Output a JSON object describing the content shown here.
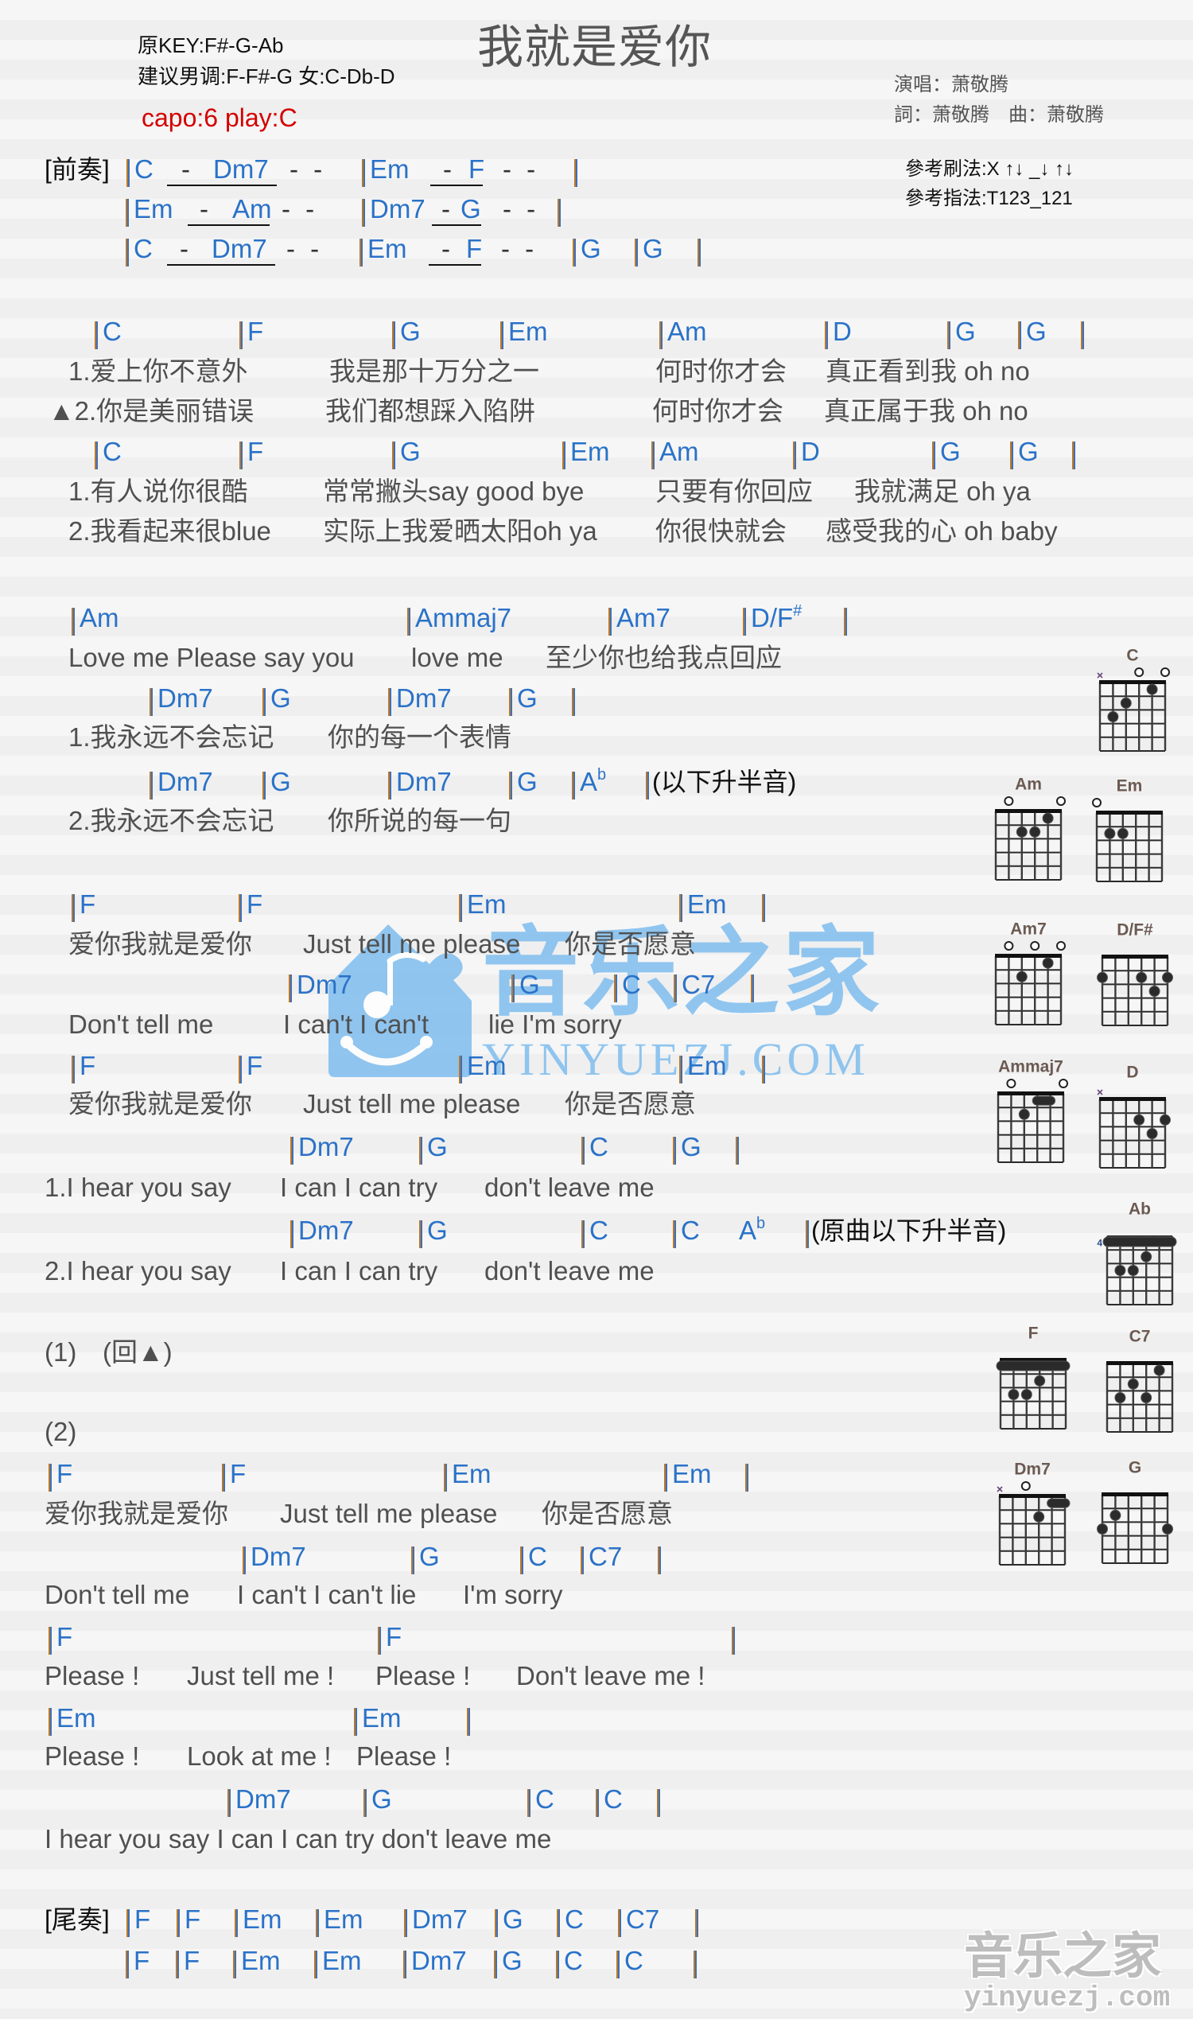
{
  "header": {
    "original_key": "原KEY:F#-G-Ab",
    "suggested_key": "建议男调:F-F#-G 女:C-Db-D",
    "capo": "capo:6 play:C",
    "title": "我就是爱你",
    "singer": "演唱：萧敬腾",
    "credits": "詞：萧敬腾　曲：萧敬腾",
    "strum": "參考刷法:X ↑↓ _↓ ↑↓",
    "fingering": "參考指法:T123_121"
  },
  "colors": {
    "chord": "#2a72c8",
    "bar": "#b8792c",
    "lyric": "#505050",
    "text": "#111111",
    "capo": "#d40000",
    "title": "#555555",
    "watermark": "#7fbdee",
    "diagram_label": "#6b5a52"
  },
  "prelude": {
    "label": "[前奏]",
    "rows": [
      {
        "chords": [
          "C",
          "Dm7",
          "Em",
          "F"
        ],
        "dashes": [
          "-",
          "- -",
          "-",
          "- -"
        ]
      },
      {
        "chords": [
          "Em",
          "Am",
          "Dm7",
          "G"
        ],
        "dashes": [
          "-",
          "- -",
          "-",
          "- -"
        ]
      },
      {
        "chords": [
          "C",
          "Dm7",
          "Em",
          "F",
          "G",
          "G"
        ],
        "dashes": [
          "-",
          "- -",
          "-",
          "- -"
        ]
      }
    ]
  },
  "verse": {
    "rows": [
      {
        "chords": [
          "C",
          "F",
          "G",
          "Em",
          "Am",
          "D",
          "G",
          "G"
        ],
        "lyrics": [
          [
            "1.爱上你不意外",
            "我是那十万分之一",
            "何时你才会",
            "真正看到我 oh no"
          ],
          [
            "▲2.你是美丽错误",
            "我们都想踩入陷阱",
            "何时你才会",
            "真正属于我 oh no"
          ]
        ]
      },
      {
        "chords": [
          "C",
          "F",
          "G",
          "Em",
          "Am",
          "D",
          "G",
          "G"
        ],
        "lyrics": [
          [
            "1.有人说你很酷",
            "常常撇头say good bye",
            "只要有你回应",
            "我就满足 oh ya"
          ],
          [
            "2.我看起来很blue",
            "实际上我爱晒太阳oh ya",
            "你很快就会",
            "感受我的心 oh baby"
          ]
        ]
      }
    ]
  },
  "pre_chorus": {
    "rows": [
      {
        "chords": [
          "Am",
          "Ammaj7",
          "Am7",
          "D/F#"
        ],
        "lyrics": [
          "Love me Please say you",
          "love me",
          "至少你也给我点回应"
        ]
      },
      {
        "chords": [
          "Dm7",
          "G",
          "Dm7",
          "G"
        ],
        "lyrics": [
          "1.我永远不会忘记",
          "你的每一个表情"
        ]
      },
      {
        "chords": [
          "Dm7",
          "G",
          "Dm7",
          "G",
          "Ab"
        ],
        "note": "(以下升半音)",
        "lyrics": [
          "2.我永远不会忘记",
          "你所说的每一句"
        ]
      }
    ]
  },
  "chorus": {
    "rows": [
      {
        "chords": [
          "F",
          "F",
          "Em",
          "Em"
        ],
        "lyrics": [
          "爱你我就是爱你",
          "Just tell me please",
          "你是否愿意"
        ]
      },
      {
        "chords": [
          "Dm7",
          "G",
          "C",
          "C7"
        ],
        "lyrics": [
          "Don't tell me",
          "I can't I can't",
          "lie I'm sorry"
        ]
      },
      {
        "chords": [
          "F",
          "F",
          "Em",
          "Em"
        ],
        "lyrics": [
          "爱你我就是爱你",
          "Just tell me please",
          "你是否愿意"
        ]
      },
      {
        "chords": [
          "Dm7",
          "G",
          "C",
          "G"
        ],
        "lyrics": [
          "1.I hear you say",
          "I can I can try",
          "don't leave me"
        ]
      },
      {
        "chords": [
          "Dm7",
          "G",
          "C",
          "C",
          "Ab"
        ],
        "note": "(原曲以下升半音)",
        "lyrics": [
          "2.I hear you say",
          "I can I can try",
          "don't leave me"
        ]
      }
    ]
  },
  "repeat": {
    "first": "(1)",
    "first_instruction": "(回▲)",
    "second": "(2)"
  },
  "ending": {
    "rows": [
      {
        "chords": [
          "F",
          "F",
          "Em",
          "Em"
        ],
        "lyrics": [
          "爱你我就是爱你",
          "Just tell me please",
          "你是否愿意"
        ]
      },
      {
        "chords": [
          "Dm7",
          "G",
          "C",
          "C7"
        ],
        "lyrics": [
          "Don't tell me",
          "I can't I can't lie",
          "I'm sorry"
        ]
      },
      {
        "chords": [
          "F",
          "F"
        ],
        "lyrics": [
          "Please !",
          "Just tell me !",
          "Please !",
          "Don't leave me !"
        ]
      },
      {
        "chords": [
          "Em",
          "Em"
        ],
        "lyrics": [
          "Please !",
          "Look at me !",
          "Please !"
        ]
      },
      {
        "chords": [
          "Dm7",
          "G",
          "C",
          "C"
        ],
        "lyrics": [
          "I hear you say I can I can try don't leave me"
        ]
      }
    ]
  },
  "outro": {
    "label": "[尾奏]",
    "rows": [
      {
        "chords": [
          "F",
          "F",
          "Em",
          "Em",
          "Dm7",
          "G",
          "C",
          "C7"
        ]
      },
      {
        "chords": [
          "F",
          "F",
          "Em",
          "Em",
          "Dm7",
          "G",
          "C",
          "C"
        ]
      }
    ]
  },
  "chord_diagrams": [
    {
      "name": "C",
      "markers": [
        "x",
        "",
        "",
        "o",
        "",
        "o"
      ],
      "dots": [
        [
          5,
          3
        ],
        [
          4,
          2
        ],
        [
          2,
          1
        ]
      ]
    },
    {
      "name": "Am",
      "markers": [
        "",
        "o",
        "",
        "",
        "",
        "o"
      ],
      "dots": [
        [
          4,
          2
        ],
        [
          3,
          2
        ],
        [
          2,
          1
        ]
      ]
    },
    {
      "name": "Em",
      "markers": [
        "o",
        "",
        "",
        "",
        "",
        ""
      ],
      "dots": [
        [
          5,
          2
        ],
        [
          4,
          2
        ]
      ]
    },
    {
      "name": "Am7",
      "markers": [
        "",
        "o",
        "",
        "o",
        "",
        "o"
      ],
      "dots": [
        [
          4,
          2
        ],
        [
          2,
          1
        ]
      ]
    },
    {
      "name": "D/F#",
      "markers": [
        "",
        "",
        "",
        "",
        "",
        ""
      ],
      "dots": [
        [
          6,
          2
        ],
        [
          3,
          2
        ],
        [
          1,
          2
        ],
        [
          2,
          3
        ]
      ]
    },
    {
      "name": "Ammaj7",
      "markers": [
        "",
        "o",
        "",
        "",
        "",
        "o"
      ],
      "barres": [
        {
          "fret": 1,
          "from": 3,
          "to": 2
        }
      ],
      "dots": [
        [
          4,
          2
        ]
      ]
    },
    {
      "name": "D",
      "markers": [
        "x",
        "",
        "",
        "",
        "",
        ""
      ],
      "dots": [
        [
          3,
          2
        ],
        [
          1,
          2
        ],
        [
          2,
          3
        ]
      ]
    },
    {
      "name": "Ab",
      "base_fret": 4,
      "barres": [
        {
          "fret": 1,
          "from": 6,
          "to": 1
        }
      ],
      "dots": [
        [
          3,
          2
        ],
        [
          5,
          3
        ],
        [
          4,
          3
        ]
      ]
    },
    {
      "name": "F",
      "barres": [
        {
          "fret": 1,
          "from": 6,
          "to": 1
        }
      ],
      "dots": [
        [
          3,
          2
        ],
        [
          5,
          3
        ],
        [
          4,
          3
        ]
      ]
    },
    {
      "name": "C7",
      "dots": [
        [
          2,
          1
        ],
        [
          4,
          2
        ],
        [
          5,
          3
        ],
        [
          3,
          3
        ]
      ]
    },
    {
      "name": "Dm7",
      "markers": [
        "x",
        "",
        "o",
        "",
        "",
        ""
      ],
      "barres": [
        {
          "fret": 1,
          "from": 2,
          "to": 1
        }
      ],
      "dots": [
        [
          3,
          2
        ]
      ]
    },
    {
      "name": "G",
      "dots": [
        [
          5,
          2
        ],
        [
          6,
          3
        ],
        [
          1,
          3
        ]
      ]
    }
  ],
  "watermark": {
    "cn": "音乐之家",
    "en": "YINYUEZJ.COM"
  },
  "footer_logo": {
    "cn": "音乐之家",
    "en": "yinyuezj.com"
  }
}
